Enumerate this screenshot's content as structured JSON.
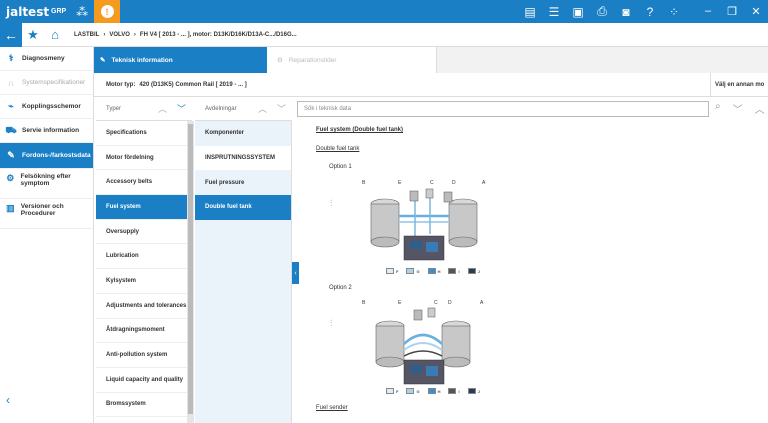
{
  "app": {
    "logo": "jaltest",
    "group": "GRP"
  },
  "breadcrumb": [
    "LASTBIL",
    "VOLVO",
    "FH V4 [ 2013 - ... ], motor: D13K/D16K/D13A-C.../D16G..."
  ],
  "sidebar": {
    "items": [
      {
        "label": "Diagnosmeny",
        "icon": "stethoscope-icon"
      },
      {
        "label": "Systemspecifikationer",
        "icon": "headset-icon"
      },
      {
        "label": "Kopplingsschemor",
        "icon": "wiring-icon"
      },
      {
        "label": "Servie information",
        "icon": "truck-icon"
      },
      {
        "label": "Fordons-/farkostsdata",
        "icon": "wrench-icon"
      },
      {
        "label": "Felsökning efter symptom",
        "icon": "search-cog-icon"
      },
      {
        "label": "Versioner och Procedurer",
        "icon": "document-icon"
      }
    ]
  },
  "tabs": {
    "active": "Teknisk information",
    "inactive": "Reparationstider"
  },
  "motor": {
    "label": "Motor typ:",
    "value": "420 (D13K5) Common Rail [ 2019 - ... ]",
    "right": "Välj en annan mo"
  },
  "columns": {
    "typer": {
      "title": "Typer",
      "items": [
        "Specifications",
        "Motor fördelning",
        "Accessory belts",
        "Fuel system",
        "Oversupply",
        "Lubrication",
        "Kylsystem",
        "Adjustments and tolerances",
        "Åtdragningsmoment",
        "Anti-pollution system",
        "Liquid capacity and quality",
        "Bromssystem"
      ]
    },
    "avdelningar": {
      "title": "Avdelningar",
      "items": [
        "Komponenter",
        "INSPRUTNINGSSYSTEM",
        "Fuel pressure",
        "Double fuel tank"
      ]
    }
  },
  "search": {
    "placeholder": "Sök i teknisk data"
  },
  "content": {
    "title": "Fuel system (Double fuel tank)",
    "subtitle": "Double fuel tank",
    "option1": "Option 1",
    "option2": "Option 2",
    "footer_link": "Fuel sender",
    "fig_letters": [
      "B",
      "E",
      "C",
      "D",
      "A"
    ],
    "legend": [
      "F",
      "G",
      "H",
      "I",
      "J"
    ]
  },
  "colors": {
    "accent": "#1a7fc4",
    "warning": "#f39a1f"
  }
}
